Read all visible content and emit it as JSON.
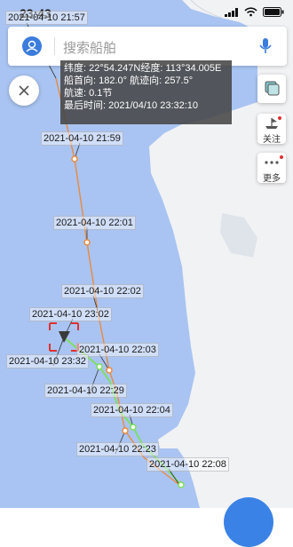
{
  "status_bar": {
    "time": "23:43"
  },
  "search": {
    "placeholder": "搜索船舶"
  },
  "info": {
    "line1": "纬度: 22°54.247N经度: 113°34.005E",
    "line2": "船首向: 182.0° 航迹向: 257.5°",
    "line3": "航速: 0.1节",
    "line4": "最后时间: 2021/04/10 23:32:10"
  },
  "side": {
    "follow_label": "关注",
    "more_label": "更多"
  },
  "track": {
    "labels": [
      "2021-04-10 21:57",
      "2021-04-10 21:59",
      "2021-04-10 22:01",
      "2021-04-10 22:02",
      "2021-04-10 23:02",
      "2021-04-10 22:03",
      "2021-04-10 23:32",
      "2021-04-10 22:29",
      "2021-04-10 22:04",
      "2021-04-10 22:23",
      "2021-04-10 22:08"
    ]
  },
  "colors": {
    "sea": "#a9c4f2",
    "land": "#f1f2f4",
    "track": "#e98a3f",
    "recent_track": "#7be05a",
    "marker": "#e03030"
  }
}
